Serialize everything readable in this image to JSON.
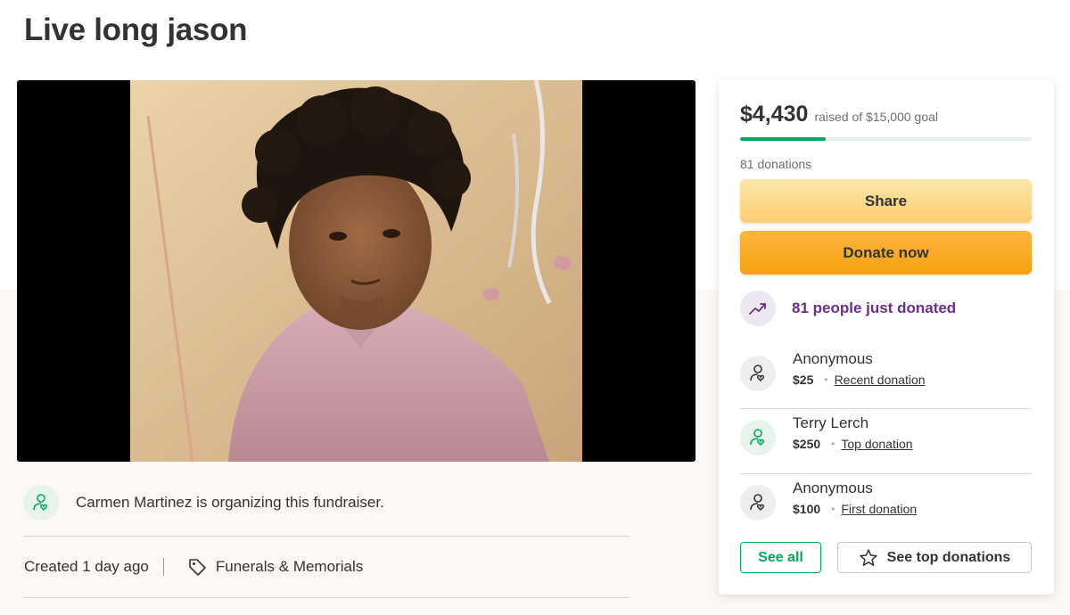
{
  "campaign": {
    "title": "Live long jason"
  },
  "organizer": {
    "text": "Carmen Martinez is organizing this fundraiser.",
    "created": "Created 1 day ago",
    "category": "Funerals & Memorials"
  },
  "donation_card": {
    "raised": "$4,430",
    "goal_text": "raised of $15,000 goal",
    "progress_fraction": 0.295,
    "donation_count": "81 donations",
    "share_label": "Share",
    "donate_label": "Donate now",
    "trend_text": "81 people just donated",
    "donors": [
      {
        "name": "Anonymous",
        "amount": "$25",
        "type": "Recent donation"
      },
      {
        "name": "Terry Lerch",
        "amount": "$250",
        "type": "Top donation"
      },
      {
        "name": "Anonymous",
        "amount": "$100",
        "type": "First donation"
      }
    ],
    "see_all_label": "See all",
    "see_top_label": "See top donations"
  },
  "colors": {
    "accent_green": "#02a95c",
    "trend_purple": "#6b2d8f",
    "donate_orange": "#f5a20e"
  }
}
